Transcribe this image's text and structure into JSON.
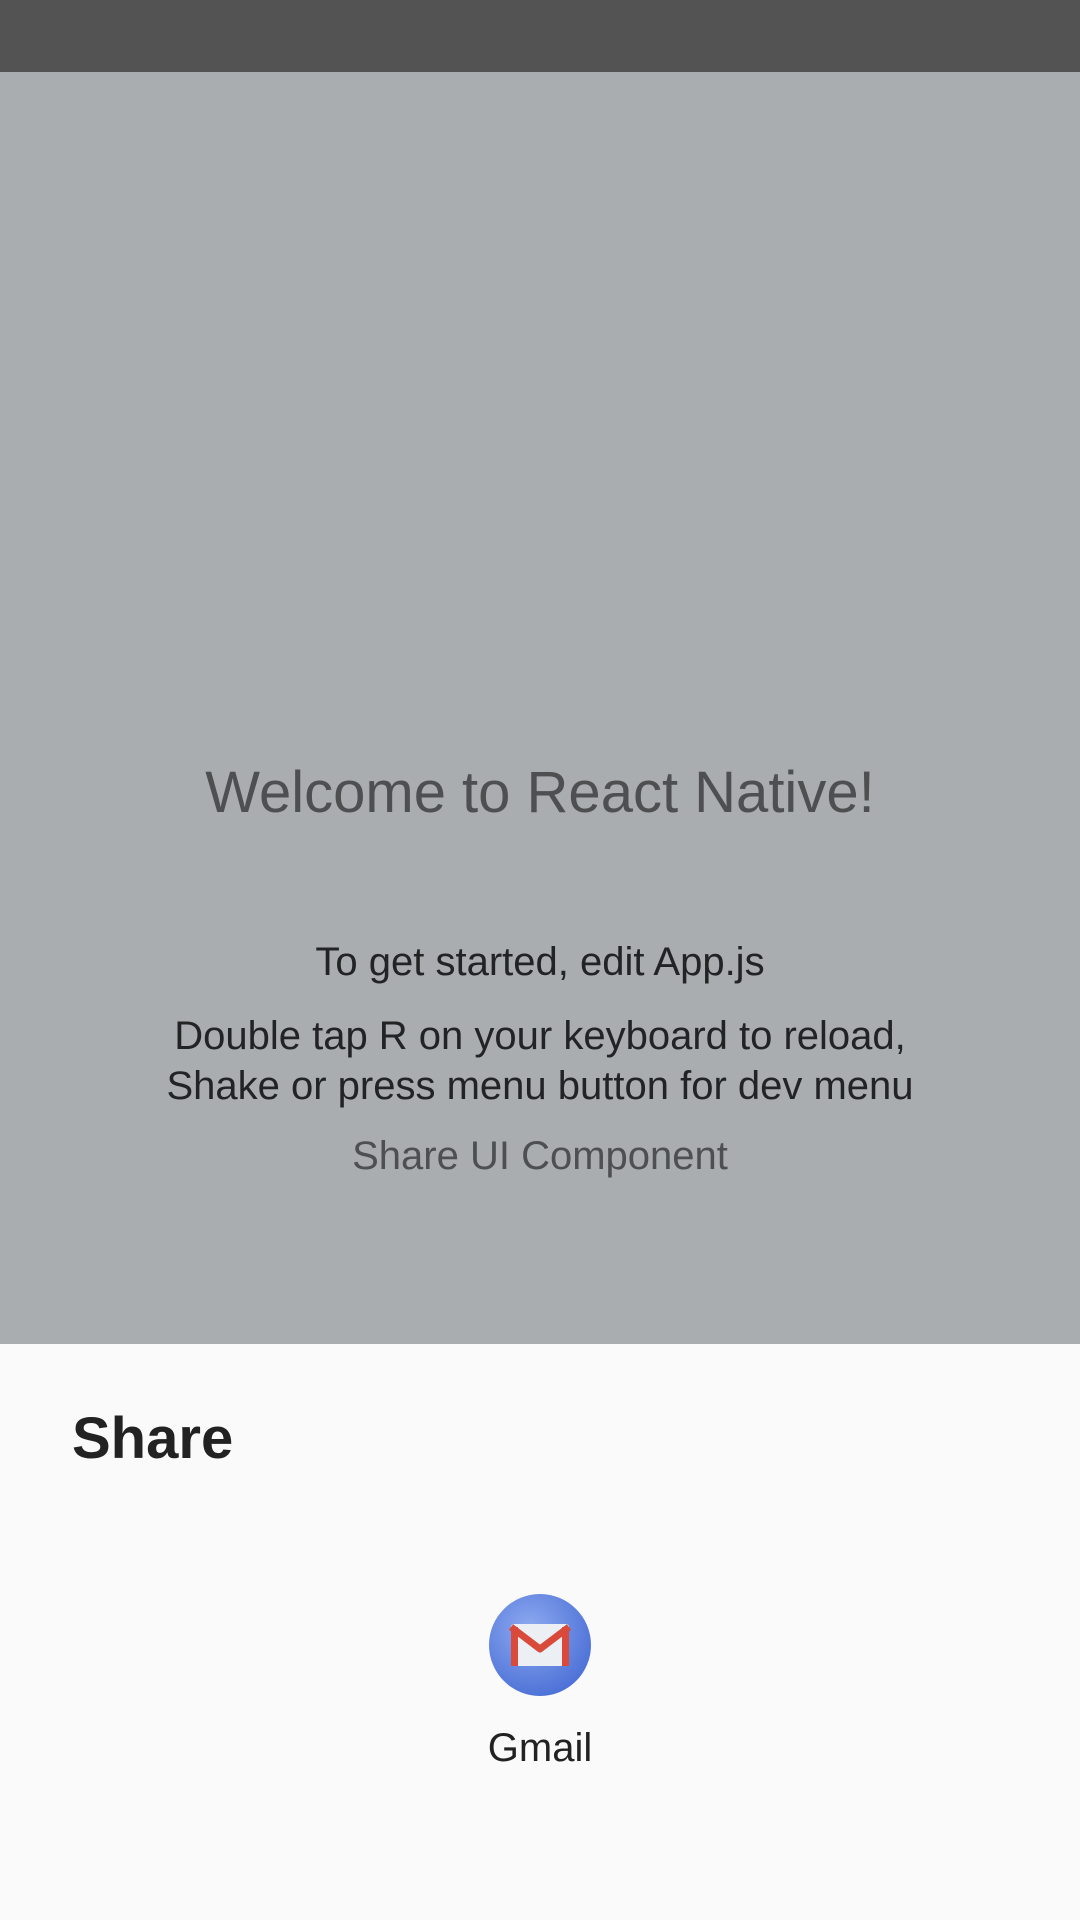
{
  "app": {
    "welcome": "Welcome to React Native!",
    "instructions_1": "To get started, edit App.js",
    "instructions_2": "Double tap R on your keyboard to reload,\nShake or press menu button for dev menu",
    "share_button_label": "Share UI Component"
  },
  "share_sheet": {
    "title": "Share",
    "targets": [
      {
        "label": "Gmail",
        "icon": "gmail-icon"
      }
    ]
  },
  "colors": {
    "status_bar": "#535353",
    "scrim_background": "#a9adb0",
    "sheet_background": "#fafafa",
    "gmail_circle": "#5b7fe0",
    "gmail_envelope": "#d94a3a"
  }
}
